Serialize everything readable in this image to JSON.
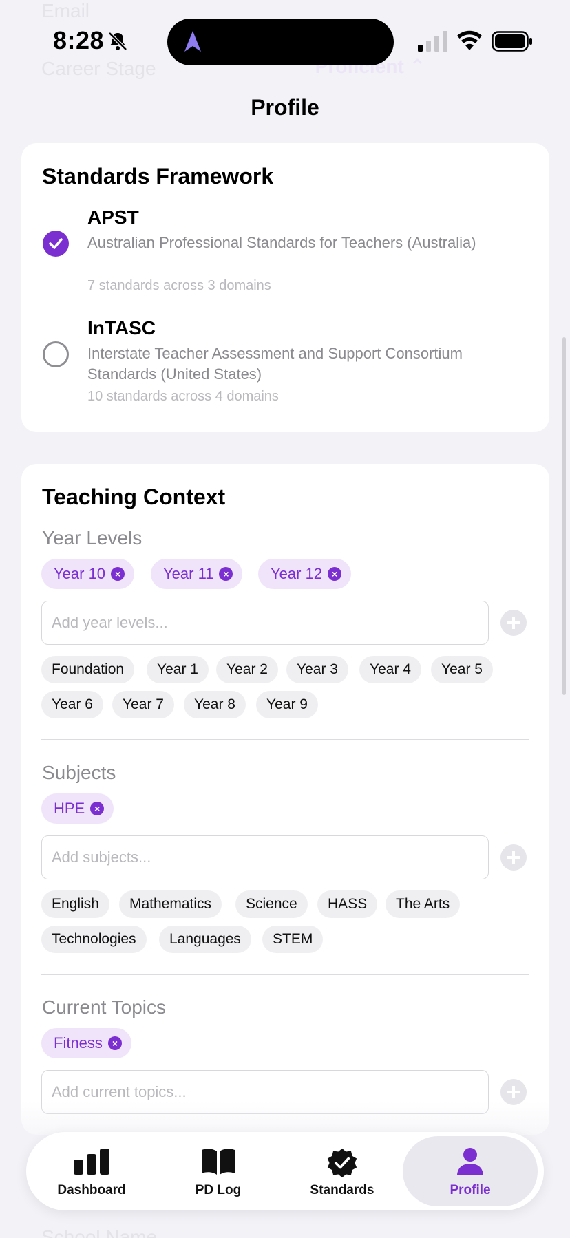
{
  "status_bar": {
    "time": "8:28"
  },
  "ghost": {
    "row1": "Email",
    "row2": "Career Stage",
    "row2_value": "Proficient ⌃",
    "bottom": "School Name"
  },
  "nav": {
    "title": "Profile"
  },
  "framework": {
    "title": "Standards Framework",
    "options": [
      {
        "name": "APST",
        "description": "Australian Professional Standards for Teachers (Australia)",
        "meta": "7 standards across 3 domains",
        "selected": true
      },
      {
        "name": "InTASC",
        "description": "Interstate Teacher Assessment and Support Consortium Standards (United States)",
        "meta": "10 standards across 4 domains",
        "selected": false
      }
    ]
  },
  "context": {
    "title": "Teaching Context",
    "year_levels": {
      "label": "Year Levels",
      "selected": [
        "Year 10",
        "Year 11",
        "Year 12"
      ],
      "placeholder": "Add year levels...",
      "suggestions": [
        "Foundation",
        "Year 1",
        "Year 2",
        "Year 3",
        "Year 4",
        "Year 5",
        "Year 6",
        "Year 7",
        "Year 8",
        "Year 9"
      ]
    },
    "subjects": {
      "label": "Subjects",
      "selected": [
        "HPE"
      ],
      "placeholder": "Add subjects...",
      "suggestions": [
        "English",
        "Mathematics",
        "Science",
        "HASS",
        "The Arts",
        "Technologies",
        "Languages",
        "STEM"
      ]
    },
    "topics": {
      "label": "Current Topics",
      "selected": [
        "Fitness"
      ],
      "placeholder": "Add current topics..."
    }
  },
  "tabs": [
    {
      "label": "Dashboard",
      "icon": "chart-bar-icon"
    },
    {
      "label": "PD Log",
      "icon": "book-icon"
    },
    {
      "label": "Standards",
      "icon": "checkmark-seal-icon"
    },
    {
      "label": "Profile",
      "icon": "person-icon",
      "active": true
    }
  ],
  "colors": {
    "accent": "#7b2fd1",
    "accent_light": "#efe4fa",
    "background": "#f2f2f7"
  }
}
